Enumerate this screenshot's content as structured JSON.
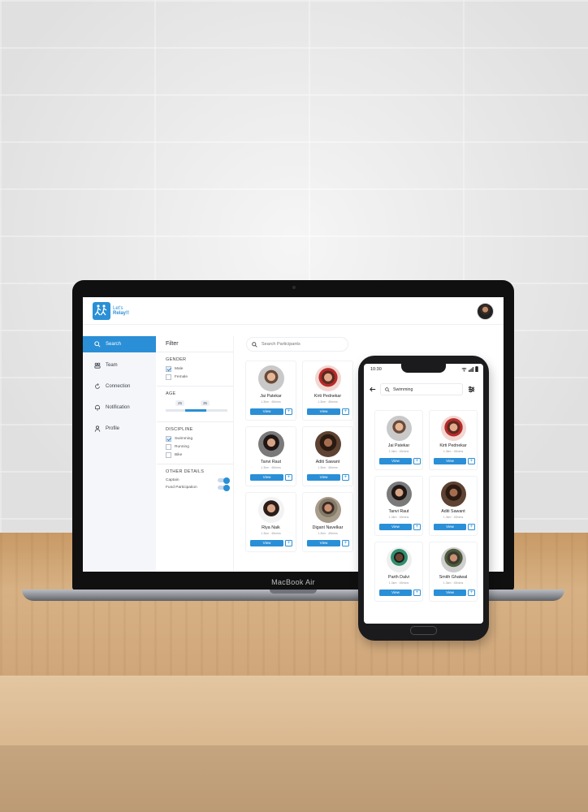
{
  "laptop": {
    "brand": "MacBook Air",
    "logo": {
      "line1": "Let's",
      "line2": "Relay!!"
    },
    "sidebar": {
      "items": [
        {
          "label": "Search",
          "icon": "search-icon",
          "active": true
        },
        {
          "label": "Team",
          "icon": "team-icon",
          "active": false
        },
        {
          "label": "Connection",
          "icon": "connection-icon",
          "active": false
        },
        {
          "label": "Notification",
          "icon": "bell-icon",
          "active": false
        },
        {
          "label": "Profile",
          "icon": "user-icon",
          "active": false
        }
      ]
    },
    "filter": {
      "title": "Filter",
      "gender": {
        "heading": "GENDER",
        "options": [
          "Male",
          "Female"
        ],
        "checked": [
          "Male"
        ]
      },
      "age": {
        "heading": "AGE",
        "min": "25",
        "max": "35"
      },
      "discipline": {
        "heading": "DISCIPLINE",
        "options": [
          "Swimming",
          "Running",
          "Bike"
        ],
        "checked": [
          "Swimming"
        ]
      },
      "other": {
        "heading": "OTHER DETAILS",
        "toggles": [
          "Captain",
          "Fund Participation"
        ]
      }
    },
    "search": {
      "placeholder": "Search Participants"
    },
    "participants": [
      {
        "name": "Jai Patekar",
        "meta": "1.3km · 45mins"
      },
      {
        "name": "Kirti Pednekar",
        "meta": "1.3km · 45mins"
      },
      {
        "name": "Tanvi Raut",
        "meta": "1.3km · 45mins"
      },
      {
        "name": "Aditi Sawant",
        "meta": "1.3km · 45mins"
      },
      {
        "name": "Riya Naik",
        "meta": "1.3km · 45mins"
      },
      {
        "name": "Digant Navelkar",
        "meta": "1.3km · 45mins"
      }
    ],
    "view_label": "View",
    "add_label": "+"
  },
  "phone": {
    "status_time": "10:30",
    "search_value": "Swimming",
    "participants": [
      {
        "name": "Jai Patekar",
        "meta": "1.3km · 45mins"
      },
      {
        "name": "Kirti Pednekar",
        "meta": "1.3km · 45mins"
      },
      {
        "name": "Tanvi Raut",
        "meta": "1.3km · 45mins"
      },
      {
        "name": "Aditi Sawant",
        "meta": "1.3km · 45mins"
      },
      {
        "name": "Parth Dalvi",
        "meta": "1.3km · 45mins"
      },
      {
        "name": "Smith Ghatwal",
        "meta": "1.3km · 45mins"
      }
    ],
    "view_label": "View",
    "add_label": "+"
  },
  "colors": {
    "accent": "#2a8fd6",
    "sidebar_bg": "#f4f6f9"
  }
}
